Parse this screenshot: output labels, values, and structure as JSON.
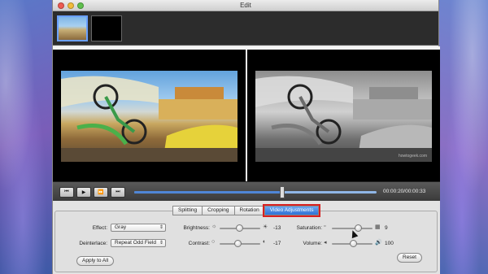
{
  "window": {
    "title": "Edit"
  },
  "thumbnails": [
    {
      "kind": "scene",
      "selected": true
    },
    {
      "kind": "black",
      "selected": false
    }
  ],
  "preview": {
    "watermark": "howtogeek.com"
  },
  "player": {
    "buttons": [
      "rewind-icon",
      "play-icon",
      "fast-forward-icon",
      "skip-end-icon"
    ],
    "progress_percent": 61,
    "timecode": "00:00:20/00:00:33"
  },
  "tabs": [
    {
      "label": "Splitting",
      "active": false
    },
    {
      "label": "Cropping",
      "active": false
    },
    {
      "label": "Rotation",
      "active": false
    },
    {
      "label": "Video Adjustments",
      "active": true
    }
  ],
  "adjustments": {
    "effect": {
      "label": "Effect:",
      "value": "Gray"
    },
    "deinterlace": {
      "label": "Deinterlace:",
      "value": "Repeat Odd Field"
    },
    "brightness": {
      "label": "Brightness:",
      "value": "-13"
    },
    "contrast": {
      "label": "Contrast:",
      "value": "-17"
    },
    "saturation": {
      "label": "Saturation:",
      "value": "9"
    },
    "volume": {
      "label": "Volume:",
      "value": "100"
    }
  },
  "buttons": {
    "apply_to_all": "Apply to All",
    "reset": "Reset"
  }
}
